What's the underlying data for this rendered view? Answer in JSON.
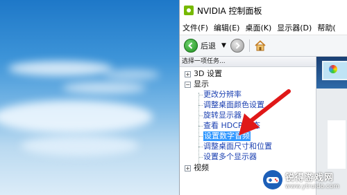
{
  "window": {
    "title": "NVIDIA 控制面板"
  },
  "menubar": {
    "items": [
      "文件(F)",
      "编辑(E)",
      "桌面(K)",
      "显示器(D)",
      "帮助("
    ]
  },
  "toolbar": {
    "back_label": "后退"
  },
  "task_panel": {
    "header": "选择一项任务...",
    "tree": {
      "node_3d": "3D 设置",
      "node_display": "显示",
      "display_children": [
        "更改分辨率",
        "调整桌面颜色设置",
        "旋转显示器",
        "查看 HDCP 状态",
        "设置数字音频",
        "调整桌面尺寸和位置",
        "设置多个显示器"
      ],
      "selected_index": 4,
      "node_video": "视频"
    }
  },
  "watermark": {
    "title": "锐得游戏网",
    "url": "www.ytruido.com"
  },
  "colors": {
    "selection": "#3399ff",
    "link": "#1a3fb0",
    "nvidia_green": "#76b900",
    "arrow": "#e01818"
  }
}
